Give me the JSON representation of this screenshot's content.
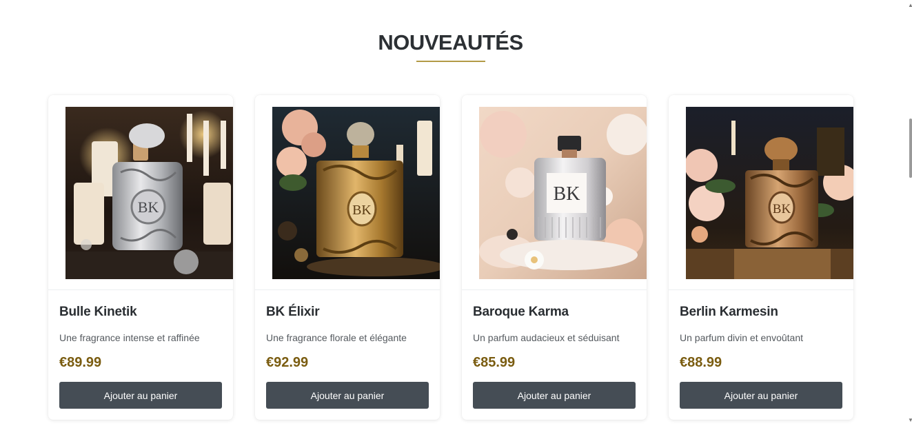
{
  "section": {
    "title": "NOUVEAUTÉS",
    "accent_color": "#b39a46"
  },
  "products": [
    {
      "name": "Bulle Kinetik",
      "description": "Une fragrance intense et raffinée",
      "price": "€89.99",
      "button_label": "Ajouter au panier",
      "image_icon": "perfume-bottle-silver-ornate",
      "logo_text": "BK"
    },
    {
      "name": "BK Élixir",
      "description": "Une fragrance florale et élégante",
      "price": "€92.99",
      "button_label": "Ajouter au panier",
      "image_icon": "perfume-bottle-gold-roses",
      "logo_text": "BK"
    },
    {
      "name": "Baroque Karma",
      "description": "Un parfum audacieux et séduisant",
      "price": "€85.99",
      "button_label": "Ajouter au panier",
      "image_icon": "perfume-bottle-glass-flowers",
      "logo_text": "BK"
    },
    {
      "name": "Berlin Karmesin",
      "description": "Un parfum divin et envoûtant",
      "price": "€88.99",
      "button_label": "Ajouter au panier",
      "image_icon": "perfume-bottle-bronze-roses",
      "logo_text": "BK"
    }
  ],
  "colors": {
    "button_bg": "#454d55",
    "price": "#7a5c10"
  }
}
